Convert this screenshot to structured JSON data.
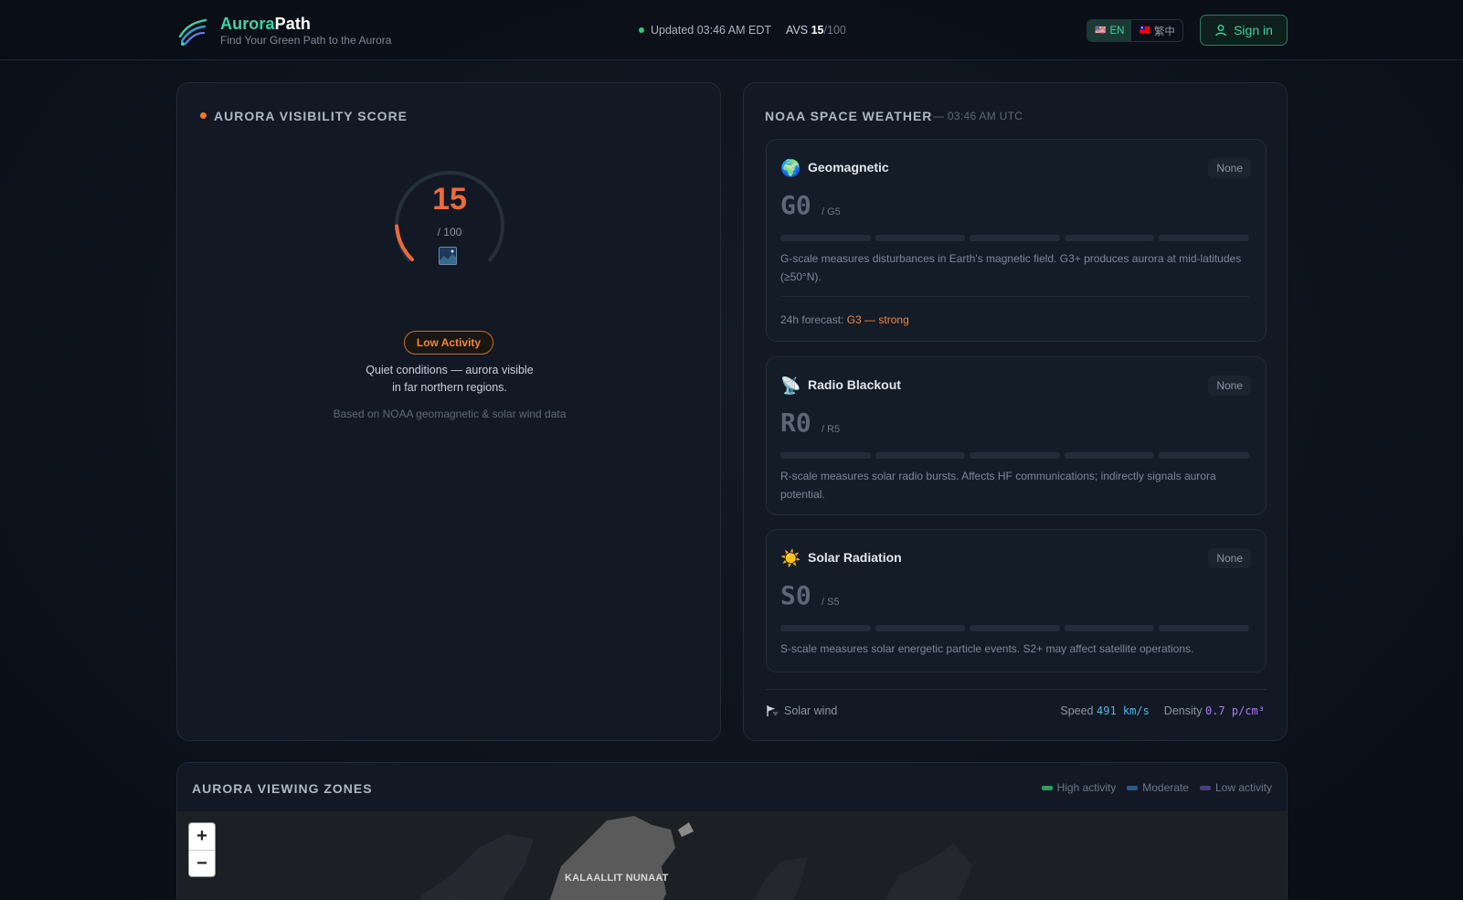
{
  "header": {
    "brand_part1": "Aurora",
    "brand_part2": "Path",
    "tagline": "Find Your Green Path to the Aurora",
    "updated": "Updated 03:46 AM EDT",
    "avs_label": "AVS",
    "avs_value": "15",
    "avs_max": "/100",
    "lang_en": "EN",
    "lang_zh": "繁中",
    "sign_in": "Sign in"
  },
  "visibility": {
    "title": "AURORA VISIBILITY SCORE",
    "score": "15",
    "score_max": "/ 100",
    "score_fraction": 0.15,
    "badge": "Low Activity",
    "description_line1": "Quiet conditions — aurora visible",
    "description_line2": "in far northern regions.",
    "basis": "Based on NOAA geomagnetic & solar wind data"
  },
  "weather": {
    "title": "NOAA SPACE WEATHER",
    "updated": "— 03:46 AM UTC",
    "scales": [
      {
        "icon": "globe-icon",
        "glyph": "🌍",
        "name": "Geomagnetic",
        "level": "None",
        "value": "G0",
        "max": "/ G5",
        "description": "G-scale measures disturbances in Earth's magnetic field. G3+ produces aurora at mid-latitudes (≥50°N).",
        "forecast_label": "24h forecast:",
        "forecast_value": "G3 — strong"
      },
      {
        "icon": "satellite-dish-icon",
        "glyph": "📡",
        "name": "Radio Blackout",
        "level": "None",
        "value": "R0",
        "max": "/ R5",
        "description": "R-scale measures solar radio bursts. Affects HF communications; indirectly signals aurora potential."
      },
      {
        "icon": "sun-icon",
        "glyph": "☀️",
        "name": "Solar Radiation",
        "level": "None",
        "value": "S0",
        "max": "/ S5",
        "description": "S-scale measures solar energetic particle events. S2+ may affect satellite operations."
      }
    ],
    "solar_wind": {
      "label": "Solar wind",
      "speed_label": "Speed",
      "speed_value": "491 km/s",
      "density_label": "Density",
      "density_value": "0.7 p/cm³"
    }
  },
  "zones": {
    "title": "AURORA VIEWING ZONES",
    "legend": [
      {
        "label": "High activity",
        "color": "#2e9e5b"
      },
      {
        "label": "Moderate",
        "color": "#2b5c86"
      },
      {
        "label": "Low activity",
        "color": "#4b3f7a"
      }
    ],
    "zoom_in": "+",
    "zoom_out": "−",
    "map_label": "KALAALLIT NUNAAT"
  },
  "colors": {
    "accent": "#3fd3a6",
    "score": "#ef6a3a",
    "badge": "#f0853f"
  }
}
